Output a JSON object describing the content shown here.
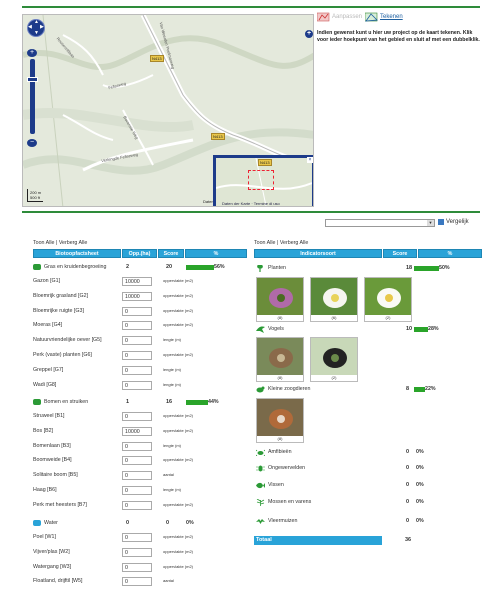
{
  "toolbar": {
    "aanpassen_label": "Aanpassen",
    "tekenen_label": "Tekenen"
  },
  "info": {
    "text": "Indien gewenst kunt u hier uw project op de kaart tekenen. Klik voor ieder hoekpunt van het gebied en sluit af met een dubbelklik."
  },
  "map": {
    "scale_top": "200 m",
    "scale_bottom": "500 ft",
    "attribution": "Daten",
    "overview_attr_1": "Daten der Karte",
    "overview_attr_2": "Termine di uso",
    "road_shield_1": "N413",
    "road_shield_2": "N413",
    "road_shield_3": "N413",
    "road_labels": [
      "Van Weerden Poelmanweg",
      "Verlengde Fellseweg",
      "Fellseweg",
      "Bovenste Weg",
      "Rooseveltlaan"
    ]
  },
  "compare": {
    "select_value": "",
    "button_label": "Vergelijk"
  },
  "left": {
    "subtitle": "Toon Alle | Verberg Alle",
    "headers": [
      "Biotoopfactsheet",
      "Opp.(ha)",
      "Score",
      "%"
    ],
    "categories": [
      {
        "name": "Gras en kruidenbegroeiing",
        "area": "2",
        "score": "20",
        "pct_label": "56%",
        "pct": 56,
        "items": [
          {
            "label": "Gazon [G1]",
            "value": "10000",
            "unit": "oppervlakte (m2)"
          },
          {
            "label": "Bloemrijk grasland [G2]",
            "value": "10000",
            "unit": "oppervlakte (m2)"
          },
          {
            "label": "Bloemrijke ruigte [G3]",
            "value": "0",
            "unit": "oppervlakte (m2)"
          },
          {
            "label": "Moeras [G4]",
            "value": "0",
            "unit": "oppervlakte (m2)"
          },
          {
            "label": "Natuurvriendelijke oever [G5]",
            "value": "0",
            "unit": "lengte (m)"
          },
          {
            "label": "Perk (vaste) planten [G6]",
            "value": "0",
            "unit": "oppervlakte (m2)"
          },
          {
            "label": "Greppel [G7]",
            "value": "0",
            "unit": "lengte (m)"
          },
          {
            "label": "Wadi [G8]",
            "value": "0",
            "unit": "lengte (m)"
          }
        ]
      },
      {
        "name": "Bomen en struiken",
        "area": "1",
        "score": "16",
        "pct_label": "44%",
        "pct": 44,
        "items": [
          {
            "label": "Struweel [B1]",
            "value": "0",
            "unit": "oppervlakte (m2)"
          },
          {
            "label": "Bos [B2]",
            "value": "10000",
            "unit": "oppervlakte (m2)"
          },
          {
            "label": "Bomenlaan [B3]",
            "value": "0",
            "unit": "lengte (m)"
          },
          {
            "label": "Boomweide [B4]",
            "value": "0",
            "unit": "oppervlakte (m2)"
          },
          {
            "label": "Solitaire boom [B5]",
            "value": "0",
            "unit": "aantal"
          },
          {
            "label": "Haag [B6]",
            "value": "0",
            "unit": "lengte (m)"
          },
          {
            "label": "Perk met heesters [B7]",
            "value": "0",
            "unit": "oppervlakte (m2)"
          }
        ]
      },
      {
        "name": "Water",
        "area": "0",
        "score": "0",
        "pct_label": "0%",
        "pct": 0,
        "items": [
          {
            "label": "Poel [W1]",
            "value": "0",
            "unit": "oppervlakte (m2)"
          },
          {
            "label": "Vijver/plas [W2]",
            "value": "0",
            "unit": "oppervlakte (m2)"
          },
          {
            "label": "Watergang [W3]",
            "value": "0",
            "unit": "oppervlakte (m2)"
          },
          {
            "label": "Floatland, drijftil [W5]",
            "value": "0",
            "unit": "aantal"
          }
        ]
      }
    ]
  },
  "right": {
    "subtitle": "Toon Alle | Verberg Alle",
    "headers": [
      "Indicatorsoort",
      "Score",
      "%"
    ],
    "groups": [
      {
        "name": "Planten",
        "score": "18",
        "pct_label": "50%",
        "pct": 50,
        "photos": [
          "(8)",
          "(6)",
          "(2)"
        ]
      },
      {
        "name": "Vogels",
        "score": "10",
        "pct_label": "28%",
        "pct": 28,
        "photos": [
          "(8)",
          "(2)"
        ]
      },
      {
        "name": "Kleine zoogdieren",
        "score": "8",
        "pct_label": "22%",
        "pct": 22,
        "photos": [
          "(8)"
        ]
      },
      {
        "name": "Amfibieën",
        "score": "0",
        "pct_label": "0%",
        "pct": 0,
        "photos": []
      },
      {
        "name": "Ongewervelden",
        "score": "0",
        "pct_label": "0%",
        "pct": 0,
        "photos": []
      },
      {
        "name": "Vissen",
        "score": "0",
        "pct_label": "0%",
        "pct": 0,
        "photos": []
      },
      {
        "name": "Mossen en varens",
        "score": "0",
        "pct_label": "0%",
        "pct": 0,
        "photos": []
      },
      {
        "name": "Vleermuizen",
        "score": "0",
        "pct_label": "0%",
        "pct": 0,
        "photos": []
      }
    ],
    "total_label": "Totaal",
    "total_value": "36"
  },
  "colors": {
    "accent_blue": "#29a3d8",
    "green_bar": "#2aa42a",
    "rule_green": "#2e8b3a",
    "nav_blue": "#1d3b8a"
  }
}
